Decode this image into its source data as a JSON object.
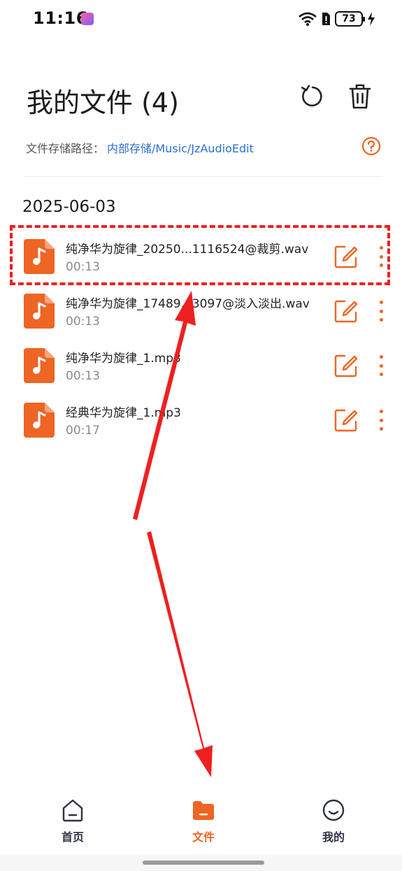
{
  "status_bar": {
    "time": "11:16",
    "battery": "73"
  },
  "header": {
    "title": "我的文件 (4)",
    "refresh_icon": "refresh-icon",
    "delete_icon": "trash-icon"
  },
  "storage_path": {
    "label": "文件存储路径：",
    "value": "内部存储/Music/JzAudioEdit",
    "help_icon": "question-circle-icon"
  },
  "date_group": "2025-06-03",
  "files": [
    {
      "name": "纯净华为旋律_20250...1116524@裁剪.wav",
      "duration": "00:13"
    },
    {
      "name": "纯净华为旋律_17489...3097@淡入淡出.wav",
      "duration": "00:13"
    },
    {
      "name": "纯净华为旋律_1.mp3",
      "duration": "00:13"
    },
    {
      "name": "经典华为旋律_1.mp3",
      "duration": "00:17"
    }
  ],
  "nav": {
    "home": "首页",
    "files": "文件",
    "mine": "我的"
  },
  "colors": {
    "accent": "#ee6524",
    "link": "#2a6fd6",
    "annotation": "#ee2020"
  }
}
